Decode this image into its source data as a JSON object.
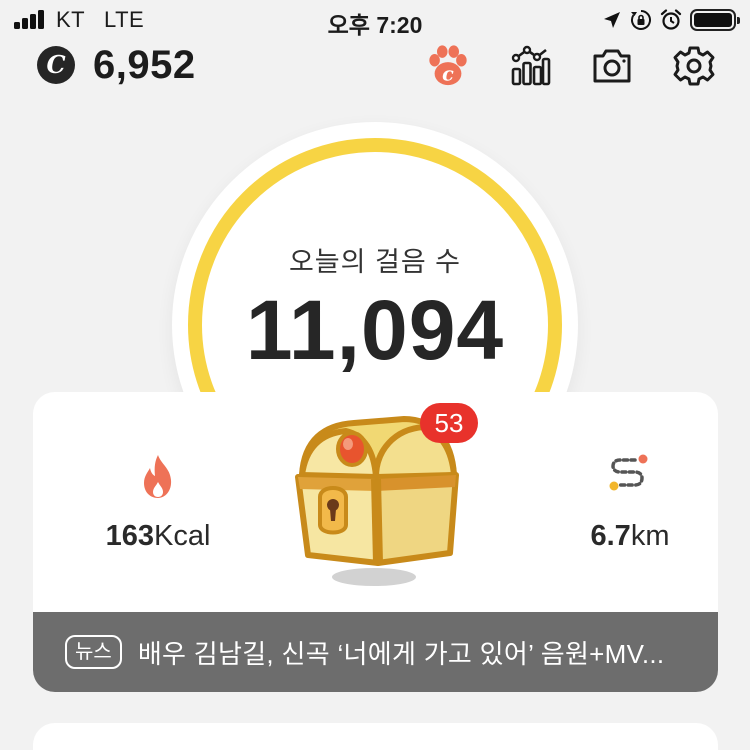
{
  "status_bar": {
    "carrier": "KT",
    "network": "LTE",
    "time": "오후 7:20"
  },
  "header": {
    "coin_symbol": "C",
    "coin_balance": "6,952"
  },
  "steps": {
    "label": "오늘의 걸음 수",
    "count": "11,094"
  },
  "stats": {
    "calories_value": "163",
    "calories_unit": "Kcal",
    "distance_value": "6.7",
    "distance_unit": "km"
  },
  "chest": {
    "badge_count": "53"
  },
  "news": {
    "tag": "뉴스",
    "headline": "배우 김남길, 신곡 ‘너에게 가고 있어’ 음원+MV..."
  },
  "colors": {
    "ring": "#f7d444",
    "accent": "#ee7257",
    "badge": "#e8322b",
    "news_bg": "#6d6d6d"
  }
}
